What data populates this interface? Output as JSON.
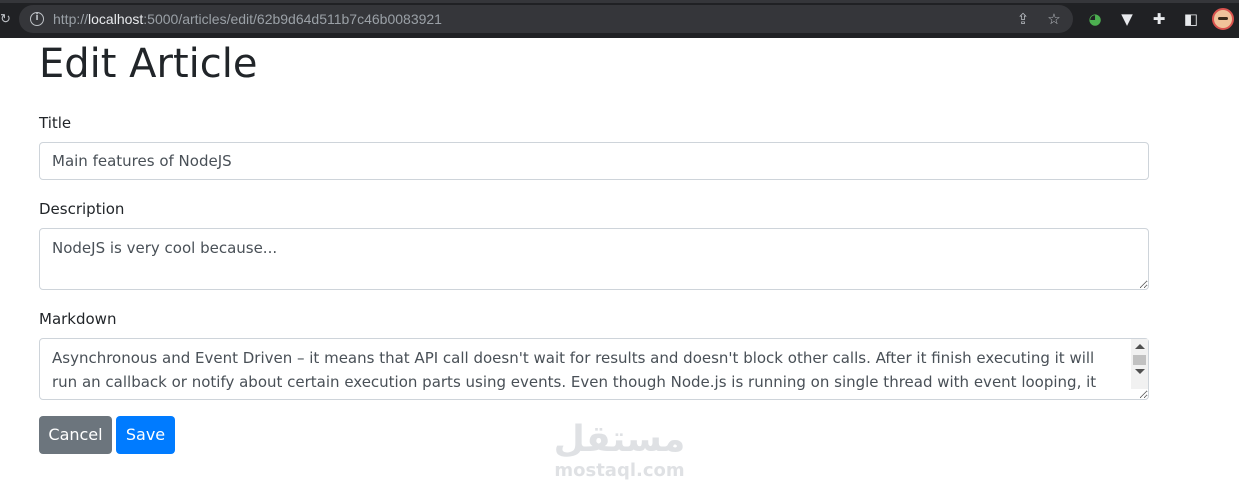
{
  "browser": {
    "url_prefix": "http://",
    "url_host": "localhost",
    "url_rest": ":5000/articles/edit/62b9d64d511b7c46b0083921",
    "toolbar_icons": [
      "share-icon",
      "bookmark-star-icon",
      "extension-icon",
      "vpn-icon",
      "puzzle-extensions-icon",
      "side-panel-icon",
      "profile-avatar"
    ]
  },
  "page": {
    "title": "Edit Article"
  },
  "form": {
    "title_label": "Title",
    "title_value": "Main features of NodeJS",
    "description_label": "Description",
    "description_value": "NodeJS is very cool because...",
    "markdown_label": "Markdown",
    "markdown_value": "Asynchronous and Event Driven – it means that API call doesn't wait for results and doesn't block other calls. After it finish executing it will run an callback or notify about certain execution parts using events. Even though Node.js is running on single thread with event looping, it can handle more",
    "cancel_label": "Cancel",
    "save_label": "Save"
  },
  "watermark": {
    "arabic": "مستقل",
    "latin": "mostaql.com"
  },
  "colors": {
    "cancel": "#6c757d",
    "save": "#007bff",
    "chrome": "#202124"
  }
}
